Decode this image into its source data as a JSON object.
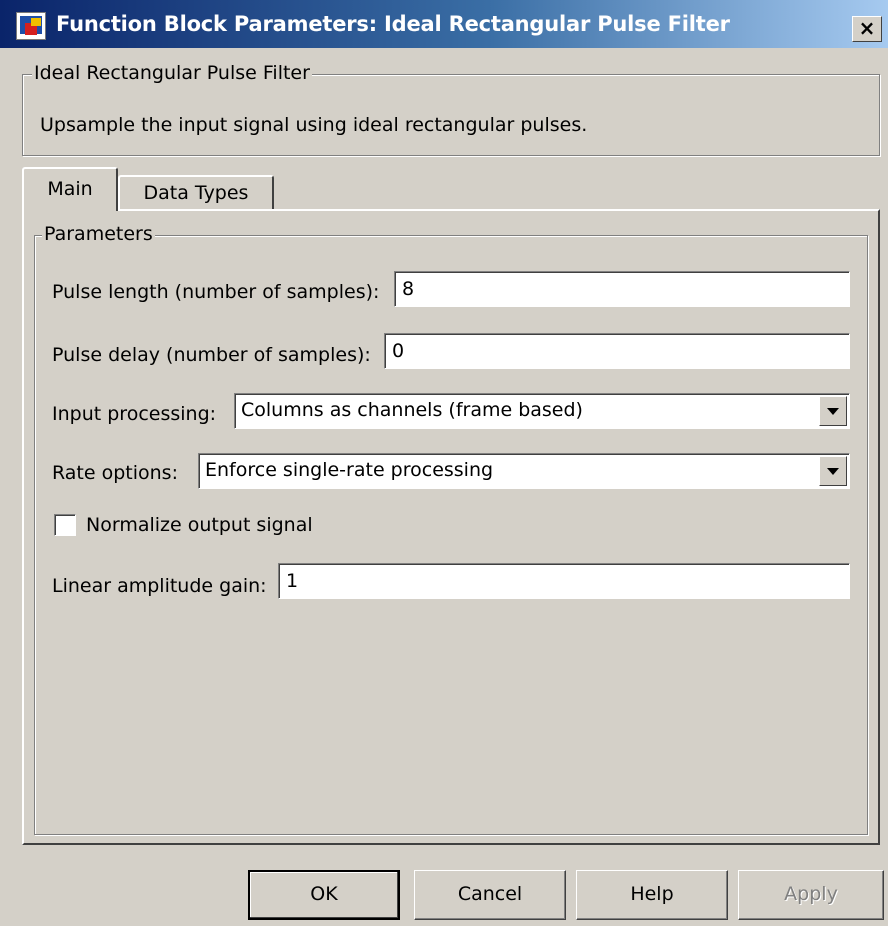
{
  "window": {
    "title": "Function Block Parameters: Ideal Rectangular Pulse Filter"
  },
  "block": {
    "group_title": "Ideal Rectangular Pulse Filter",
    "description": "Upsample the input signal using ideal rectangular pulses."
  },
  "tabs": [
    {
      "label": "Main",
      "active": true
    },
    {
      "label": "Data Types",
      "active": false
    }
  ],
  "parameters": {
    "group_title": "Parameters",
    "pulse_length": {
      "label": "Pulse length (number of samples):",
      "value": "8"
    },
    "pulse_delay": {
      "label": "Pulse delay (number of samples):",
      "value": "0"
    },
    "input_processing": {
      "label": "Input processing:",
      "selected": "Columns as channels (frame based)"
    },
    "rate_options": {
      "label": "Rate options:",
      "selected": "Enforce single-rate processing"
    },
    "normalize": {
      "label": "Normalize output signal",
      "checked": false
    },
    "linear_gain": {
      "label": "Linear amplitude gain:",
      "value": "1"
    }
  },
  "buttons": {
    "ok": "OK",
    "cancel": "Cancel",
    "help": "Help",
    "apply": "Apply"
  },
  "icons": {
    "app": "simulink-block-icon",
    "close": "close-icon",
    "dropdown": "chevron-down-icon"
  }
}
